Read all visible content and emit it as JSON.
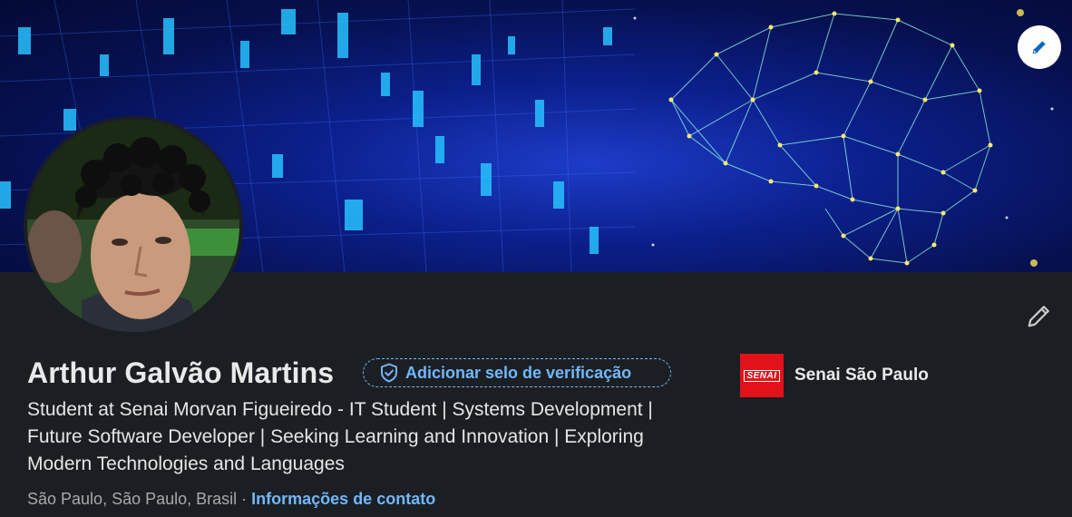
{
  "profile": {
    "name": "Arthur Galvão Martins",
    "verify_badge_label": "Adicionar selo de verificação",
    "headline": "Student at Senai Morvan Figueiredo - IT Student | Systems Development | Future Software Developer | Seeking Learning and Innovation | Exploring Modern Technologies and Languages",
    "location": "São Paulo, São Paulo, Brasil",
    "separator": "·",
    "contact_link": "Informações de contato"
  },
  "organization": {
    "logo_text": "SENAI",
    "name": "Senai São Paulo"
  },
  "icons": {
    "banner_edit": "pencil-icon",
    "profile_edit": "pencil-icon",
    "verify": "shield-check-icon"
  },
  "colors": {
    "background": "#1b1f23",
    "accent_link": "#71b7fb",
    "org_logo": "#e11219",
    "text_primary": "#e9e9e9",
    "text_secondary": "#a9a9a9"
  }
}
